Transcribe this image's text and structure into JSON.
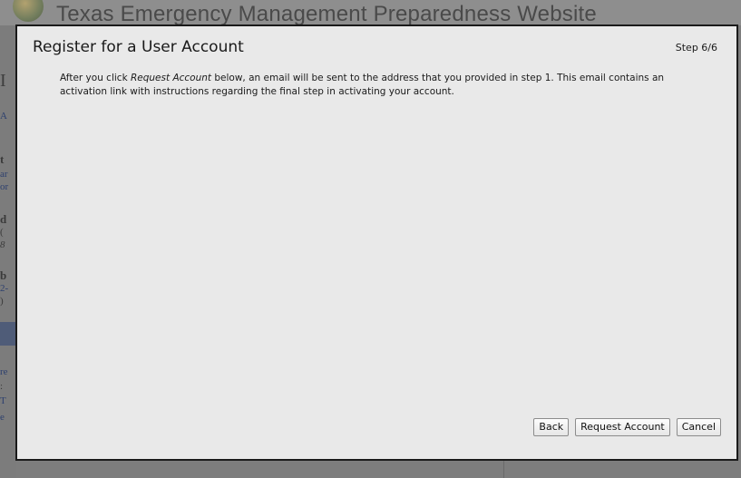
{
  "background": {
    "site_title": "Texas Emergency Management Preparedness Website",
    "left_fragments": [
      "I",
      "A",
      "t",
      "ar",
      "or",
      "d",
      "(",
      "8",
      "b",
      "2-",
      ")",
      "re",
      ": ",
      "T",
      "e"
    ]
  },
  "modal": {
    "title": "Register for a User Account",
    "step": "Step 6/6",
    "body_prefix": "After you click ",
    "body_emphasis": "Request Account",
    "body_suffix": " below, an email will be sent to the address that you provided in step 1.  This email contains an activation link with instructions regarding the final step in activating your account.",
    "buttons": {
      "back": "Back",
      "request": "Request Account",
      "cancel": "Cancel"
    }
  }
}
